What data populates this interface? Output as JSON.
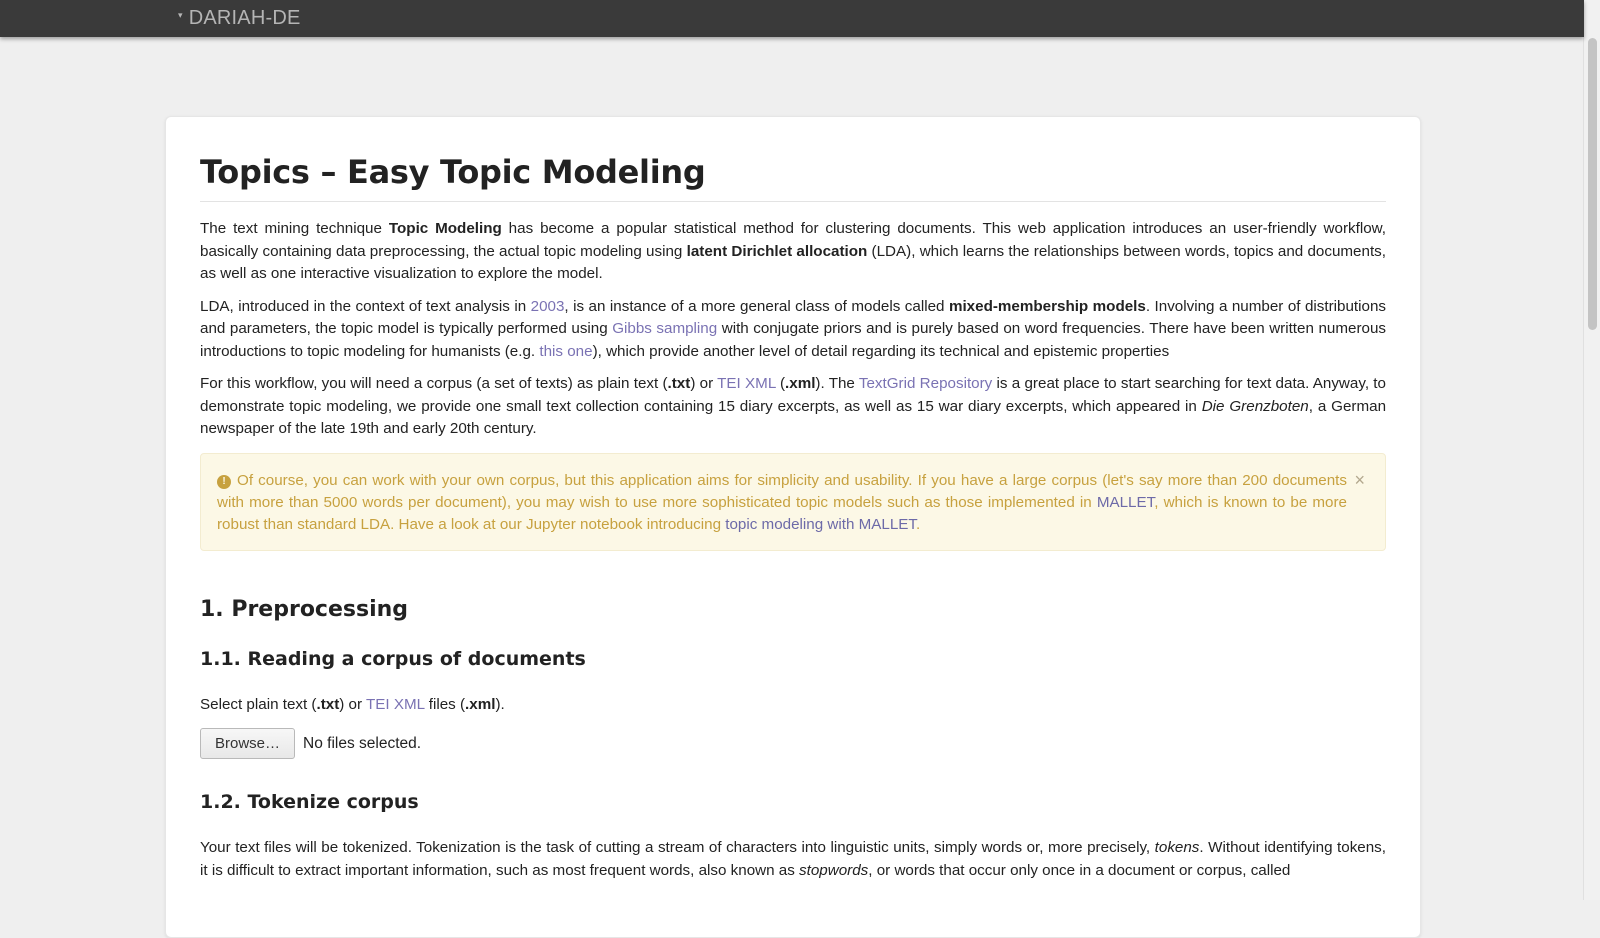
{
  "navbar": {
    "brand": "DARIAH-DE",
    "caret": "▾"
  },
  "page": {
    "title": "Topics – Easy Topic Modeling",
    "intro1": {
      "t1": "The text mining technique ",
      "b1": "Topic Modeling",
      "t2": " has become a popular statistical method for clustering documents. This web application introduces an user-friendly workflow, basically containing data preprocessing, the actual topic modeling using ",
      "b2": "latent Dirichlet allocation",
      "t3": " (LDA), which learns the relationships between words, topics and documents, as well as one interactive visualization to explore the model."
    },
    "intro2": {
      "t1": "LDA, introduced in the context of text analysis in ",
      "link_2003": "2003",
      "t2": ", is an instance of a more general class of models called ",
      "b1": "mixed-membership models",
      "t3": ". Involving a number of distributions and parameters, the topic model is typically performed using ",
      "link_gibbs": "Gibbs sampling",
      "t4": " with conjugate priors and is purely based on word frequencies. There have been written numerous introductions to topic modeling for humanists (e.g. ",
      "link_this_one": "this one",
      "t5": "), which provide another level of detail regarding its technical and epistemic properties"
    },
    "intro3": {
      "t1": "For this workflow, you will need a corpus (a set of texts) as plain text (",
      "b_txt": ".txt",
      "t2": ") or ",
      "link_tei": "TEI XML",
      "t3": " (",
      "b_xml": ".xml",
      "t4": "). The ",
      "link_textgrid": "TextGrid Repository",
      "t5": " is a great place to start searching for text data. Anyway, to demonstrate topic modeling, we provide one small text collection containing 15 diary excerpts, as well as 15 war diary excerpts, which appeared in ",
      "i1": "Die Grenzboten",
      "t6": ", a German newspaper of the late 19th and early 20th century."
    },
    "alert": {
      "icon": "!",
      "t1": "Of course, you can work with your own corpus, but this application aims for simplicity and usability. If you have a large corpus (let's say more than 200 documents with more than 5000 words per document), you may wish to use more sophisticated topic models such as those implemented in ",
      "link_mallet": "MALLET",
      "t2": ", which is known to be more robust than standard LDA. Have a look at our Jupyter notebook introducing ",
      "link_jupyter": "topic modeling with MALLET",
      "t3": ".",
      "close": "×"
    },
    "section1": {
      "heading": "1. Preprocessing"
    },
    "section1_1": {
      "heading": "1.1. Reading a corpus of documents",
      "t1": "Select plain text (",
      "b_txt": ".txt",
      "t2": ") or ",
      "link_tei": "TEI XML",
      "t3": " files (",
      "b_xml": ".xml",
      "t4": ").",
      "browse_label": "Browse…",
      "no_files": "No files selected."
    },
    "section1_2": {
      "heading": "1.2. Tokenize corpus",
      "t1": "Your text files will be tokenized. Tokenization is the task of cutting a stream of characters into linguistic units, simply words or, more precisely, ",
      "i1": "tokens",
      "t2": ". Without identifying tokens, it is difficult to extract important information, such as most frequent words, also known as ",
      "i2": "stopwords",
      "t3": ", or words that occur only once in a document or corpus, called"
    }
  }
}
